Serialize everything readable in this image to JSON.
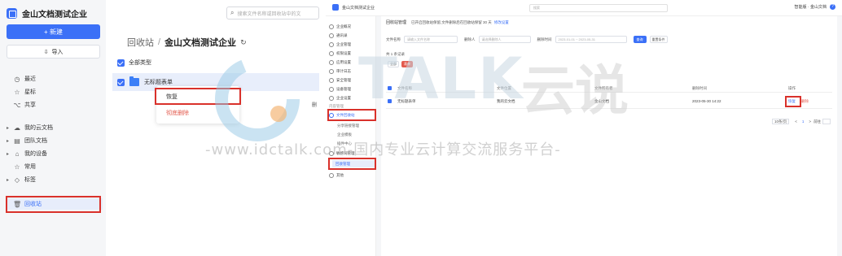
{
  "left": {
    "brand": "金山文档测试企业",
    "new_button": "+ 新建",
    "import_button": "导入",
    "search_placeholder": "搜索文件名称或回收站中的文",
    "nav": [
      {
        "label": "最近",
        "icon": "clock-icon"
      },
      {
        "label": "星标",
        "icon": "star-icon"
      },
      {
        "label": "共享",
        "icon": "share-icon"
      }
    ],
    "folders": [
      {
        "label": "我的云文档",
        "icon": "cloud-icon"
      },
      {
        "label": "团队文档",
        "icon": "team-icon"
      },
      {
        "label": "我的设备",
        "icon": "device-icon"
      },
      {
        "label": "常用",
        "icon": "star-icon"
      },
      {
        "label": "标签",
        "icon": "tag-icon"
      },
      {
        "label": "回收站",
        "icon": "trash-icon"
      }
    ],
    "breadcrumb": {
      "parent": "回收站",
      "current": "金山文档测试企业"
    },
    "all_types": "全部类型",
    "file_name": "无标题表单",
    "context_menu": {
      "restore": "恢复",
      "delete": "彻底删除"
    },
    "edge_text": "删"
  },
  "right": {
    "brand": "金山文档测试企业",
    "search_placeholder": "搜索",
    "user": "智能版 · 金山文档",
    "help": "?",
    "nav": [
      "企业概况",
      "通讯录",
      "企业管理",
      "权限设置",
      "应用设置",
      "审计日志",
      "安全管理",
      "设备管理",
      "企业设置",
      "内容管理",
      "文件回收站",
      "分享链接管理",
      "企业模板",
      "插件中心",
      "敏感词管理",
      "回收管理",
      "其他"
    ],
    "bar_title": "回收站管理",
    "bar_note": "已开启回收站保留,文件删除后在回收站保留 30 天",
    "bar_link": "修改设置",
    "filters": {
      "file_name_label": "文件名称",
      "file_name_placeholder": "请输入文件名称",
      "deleter_label": "删除人",
      "deleter_placeholder": "请选择删除人",
      "time_label": "删除时间",
      "time_value": "2023-01-01 ~ 2023-05-31",
      "query_button": "查询",
      "reset_button": "重置条件"
    },
    "count_text": "共 1 条记录",
    "tabs": [
      "全部",
      "表单"
    ],
    "columns": [
      "文件名称",
      "文件位置",
      "文件所有者",
      "删除时间",
      "操作"
    ],
    "rows": [
      {
        "name": "无标题表单",
        "location": "我的云文档",
        "owner": "金山文档",
        "time": "2023-05-30 14:22",
        "recover": "恢复",
        "delete": "删除"
      }
    ],
    "pager": {
      "size": "10条/页",
      "prev": "<",
      "page": "1",
      "next": ">",
      "goto": "前往"
    }
  },
  "watermark": {
    "brand_latin": "TALK",
    "brand_cn": "云说",
    "url": "-www.idctalk.com-国内专业云计算交流服务平台-"
  }
}
